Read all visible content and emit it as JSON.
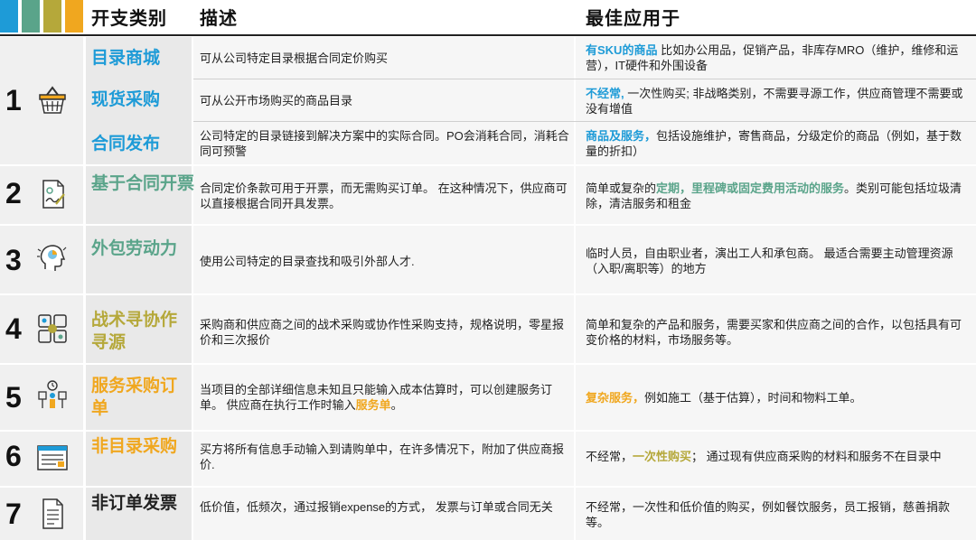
{
  "colors": {
    "blue": "#1e9bd7",
    "green": "#5aa48a",
    "olive": "#b5a83a",
    "orange": "#f0a71f",
    "stripes": [
      "#1e9bd7",
      "#5aa48a",
      "#b5a83a",
      "#f0a71f"
    ]
  },
  "header": {
    "col1": "开支类别",
    "col2": "描述",
    "col3": "最佳应用于"
  },
  "groups": [
    {
      "number": "1",
      "icon": "shopping-basket-icon",
      "rows": [
        {
          "category": "目录商城",
          "description": "可从公司特定目录根据合同定价购买",
          "best_hl": "有SKU的商品",
          "best_rest": " 比如办公用品，促销产品，非库存MRO（维护，维修和运营），IT硬件和外围设备"
        },
        {
          "category": "现货采购",
          "description": "可从公开市场购买的商品目录",
          "best_hl": "不经常,",
          "best_rest": " 一次性购买; 非战略类别，不需要寻源工作，供应商管理不需要或没有增值"
        },
        {
          "category": "合同发布",
          "description": "公司特定的目录链接到解决方案中的实际合同。PO会消耗合同，消耗合同可预警",
          "best_hl": "商品及服务，",
          "best_rest": "包括设施维护，寄售商品，分级定价的商品（例如，基于数量的折扣）"
        }
      ]
    },
    {
      "number": "2",
      "icon": "signed-document-icon",
      "category": "基于合同开票",
      "description": "合同定价条款可用于开票，而无需购买订单。 在这种情况下，供应商可以直接根据合同开具发票。",
      "best_pre": "简单或复杂的",
      "best_hl": "定期，里程碑或固定费用活动的服务",
      "best_rest": "。类别可能包括垃圾清除，清洁服务和租金"
    },
    {
      "number": "3",
      "icon": "head-idea-icon",
      "category": "外包劳动力",
      "description": "使用公司特定的目录查找和吸引外部人才.",
      "best": "临时人员，自由职业者，演出工人和承包商。 最适合需要主动管理资源（入职/离职等）的地方"
    },
    {
      "number": "4",
      "icon": "collaboration-hands-icon",
      "category": "战术寻协作寻源",
      "description": "采购商和供应商之间的战术采购或协作性采购支持，规格说明，零星报价和三次报价",
      "best": "简单和复杂的产品和服务，需要买家和供应商之间的合作，以包括具有可变价格的材料，市场服务等。"
    },
    {
      "number": "5",
      "icon": "service-timer-icon",
      "category": "服务采购订单",
      "description_pre": "当项目的全部详细信息未知且只能输入成本估算时，可以创建服务订单。 供应商在执行工作时输入",
      "description_hl": "服务单",
      "description_post": "。",
      "best_hl": "复杂服务，",
      "best_rest": "例如施工（基于估算），时间和物料工单。"
    },
    {
      "number": "6",
      "icon": "requisition-form-icon",
      "category": "非目录采购",
      "description": "买方将所有信息手动输入到请购单中，在许多情况下，附加了供应商报价.",
      "best_pre": "不经常，",
      "best_hl": "一次性购买",
      "best_rest": "； 通过现有供应商采购的材料和服务不在目录中"
    },
    {
      "number": "7",
      "icon": "document-lines-icon",
      "category": "非订单发票",
      "description": "低价值，低频次，通过报销expense的方式， 发票与订单或合同无关",
      "best": "不经常，一次性和低价值的购买，例如餐饮服务，员工报销，慈善捐款等。"
    }
  ]
}
